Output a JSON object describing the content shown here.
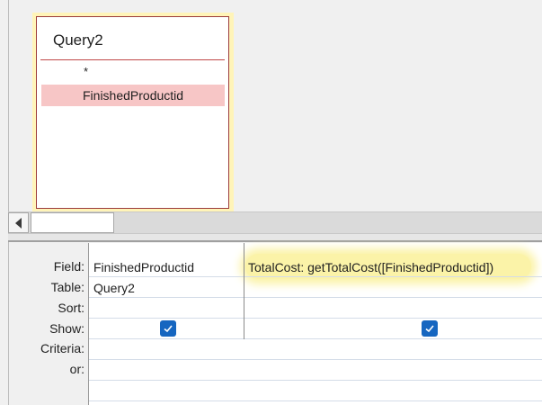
{
  "query_design": {
    "table": {
      "title": "Query2",
      "all_fields": "*",
      "selected_field": "FinishedProductid"
    }
  },
  "grid": {
    "row_labels": [
      "Field:",
      "Table:",
      "Sort:",
      "Show:",
      "Criteria:",
      "or:"
    ],
    "columns": [
      {
        "field": "FinishedProductid",
        "table": "Query2",
        "sort": "",
        "show": true
      },
      {
        "field": "TotalCost: getTotalCost([FinishedProductid])",
        "table": "",
        "sort": "",
        "show": true
      }
    ]
  },
  "colors": {
    "table_border": "#9b3b3b",
    "table_highlight": "#fff4b8",
    "selected_field_bg": "#f7c6c6",
    "checkbox": "#1666c0",
    "expression_highlight": "#fbf3a8"
  }
}
